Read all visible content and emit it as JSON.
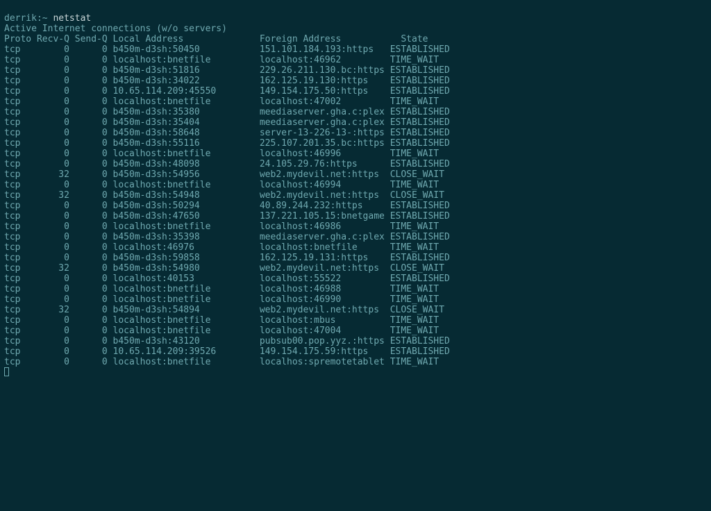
{
  "prompt": {
    "user": "derrik",
    "sep": ":",
    "path": "~",
    "command": "netstat"
  },
  "header": "Active Internet connections (w/o servers)",
  "columns": {
    "proto": "Proto",
    "recvq": "Recv-Q",
    "sendq": "Send-Q",
    "local": "Local Address",
    "foreign": "Foreign Address",
    "state": "State"
  },
  "rows": [
    {
      "proto": "tcp",
      "recvq": "0",
      "sendq": "0",
      "local": "b450m-d3sh:50450",
      "foreign": "151.101.184.193:https",
      "state": "ESTABLISHED"
    },
    {
      "proto": "tcp",
      "recvq": "0",
      "sendq": "0",
      "local": "localhost:bnetfile",
      "foreign": "localhost:46962",
      "state": "TIME_WAIT"
    },
    {
      "proto": "tcp",
      "recvq": "0",
      "sendq": "0",
      "local": "b450m-d3sh:51816",
      "foreign": "229.26.211.130.bc:https",
      "state": "ESTABLISHED"
    },
    {
      "proto": "tcp",
      "recvq": "0",
      "sendq": "0",
      "local": "b450m-d3sh:34022",
      "foreign": "162.125.19.130:https",
      "state": "ESTABLISHED"
    },
    {
      "proto": "tcp",
      "recvq": "0",
      "sendq": "0",
      "local": "10.65.114.209:45550",
      "foreign": "149.154.175.50:https",
      "state": "ESTABLISHED"
    },
    {
      "proto": "tcp",
      "recvq": "0",
      "sendq": "0",
      "local": "localhost:bnetfile",
      "foreign": "localhost:47002",
      "state": "TIME_WAIT"
    },
    {
      "proto": "tcp",
      "recvq": "0",
      "sendq": "0",
      "local": "b450m-d3sh:35380",
      "foreign": "meediaserver.gha.c:plex",
      "state": "ESTABLISHED"
    },
    {
      "proto": "tcp",
      "recvq": "0",
      "sendq": "0",
      "local": "b450m-d3sh:35404",
      "foreign": "meediaserver.gha.c:plex",
      "state": "ESTABLISHED"
    },
    {
      "proto": "tcp",
      "recvq": "0",
      "sendq": "0",
      "local": "b450m-d3sh:58648",
      "foreign": "server-13-226-13-:https",
      "state": "ESTABLISHED"
    },
    {
      "proto": "tcp",
      "recvq": "0",
      "sendq": "0",
      "local": "b450m-d3sh:55116",
      "foreign": "225.107.201.35.bc:https",
      "state": "ESTABLISHED"
    },
    {
      "proto": "tcp",
      "recvq": "0",
      "sendq": "0",
      "local": "localhost:bnetfile",
      "foreign": "localhost:46996",
      "state": "TIME_WAIT"
    },
    {
      "proto": "tcp",
      "recvq": "0",
      "sendq": "0",
      "local": "b450m-d3sh:48098",
      "foreign": "24.105.29.76:https",
      "state": "ESTABLISHED"
    },
    {
      "proto": "tcp",
      "recvq": "32",
      "sendq": "0",
      "local": "b450m-d3sh:54956",
      "foreign": "web2.mydevil.net:https",
      "state": "CLOSE_WAIT"
    },
    {
      "proto": "tcp",
      "recvq": "0",
      "sendq": "0",
      "local": "localhost:bnetfile",
      "foreign": "localhost:46994",
      "state": "TIME_WAIT"
    },
    {
      "proto": "tcp",
      "recvq": "32",
      "sendq": "0",
      "local": "b450m-d3sh:54948",
      "foreign": "web2.mydevil.net:https",
      "state": "CLOSE_WAIT"
    },
    {
      "proto": "tcp",
      "recvq": "0",
      "sendq": "0",
      "local": "b450m-d3sh:50294",
      "foreign": "40.89.244.232:https",
      "state": "ESTABLISHED"
    },
    {
      "proto": "tcp",
      "recvq": "0",
      "sendq": "0",
      "local": "b450m-d3sh:47650",
      "foreign": "137.221.105.15:bnetgame",
      "state": "ESTABLISHED"
    },
    {
      "proto": "tcp",
      "recvq": "0",
      "sendq": "0",
      "local": "localhost:bnetfile",
      "foreign": "localhost:46986",
      "state": "TIME_WAIT"
    },
    {
      "proto": "tcp",
      "recvq": "0",
      "sendq": "0",
      "local": "b450m-d3sh:35398",
      "foreign": "meediaserver.gha.c:plex",
      "state": "ESTABLISHED"
    },
    {
      "proto": "tcp",
      "recvq": "0",
      "sendq": "0",
      "local": "localhost:46976",
      "foreign": "localhost:bnetfile",
      "state": "TIME_WAIT"
    },
    {
      "proto": "tcp",
      "recvq": "0",
      "sendq": "0",
      "local": "b450m-d3sh:59858",
      "foreign": "162.125.19.131:https",
      "state": "ESTABLISHED"
    },
    {
      "proto": "tcp",
      "recvq": "32",
      "sendq": "0",
      "local": "b450m-d3sh:54980",
      "foreign": "web2.mydevil.net:https",
      "state": "CLOSE_WAIT"
    },
    {
      "proto": "tcp",
      "recvq": "0",
      "sendq": "0",
      "local": "localhost:40153",
      "foreign": "localhost:55522",
      "state": "ESTABLISHED"
    },
    {
      "proto": "tcp",
      "recvq": "0",
      "sendq": "0",
      "local": "localhost:bnetfile",
      "foreign": "localhost:46988",
      "state": "TIME_WAIT"
    },
    {
      "proto": "tcp",
      "recvq": "0",
      "sendq": "0",
      "local": "localhost:bnetfile",
      "foreign": "localhost:46990",
      "state": "TIME_WAIT"
    },
    {
      "proto": "tcp",
      "recvq": "32",
      "sendq": "0",
      "local": "b450m-d3sh:54894",
      "foreign": "web2.mydevil.net:https",
      "state": "CLOSE_WAIT"
    },
    {
      "proto": "tcp",
      "recvq": "0",
      "sendq": "0",
      "local": "localhost:bnetfile",
      "foreign": "localhost:mbus",
      "state": "TIME_WAIT"
    },
    {
      "proto": "tcp",
      "recvq": "0",
      "sendq": "0",
      "local": "localhost:bnetfile",
      "foreign": "localhost:47004",
      "state": "TIME_WAIT"
    },
    {
      "proto": "tcp",
      "recvq": "0",
      "sendq": "0",
      "local": "b450m-d3sh:43120",
      "foreign": "pubsub00.pop.yyz.:https",
      "state": "ESTABLISHED"
    },
    {
      "proto": "tcp",
      "recvq": "0",
      "sendq": "0",
      "local": "10.65.114.209:39526",
      "foreign": "149.154.175.59:https",
      "state": "ESTABLISHED"
    },
    {
      "proto": "tcp",
      "recvq": "0",
      "sendq": "0",
      "local": "localhost:bnetfile",
      "foreign": "localhos:spremotetablet",
      "state": "TIME_WAIT"
    }
  ]
}
